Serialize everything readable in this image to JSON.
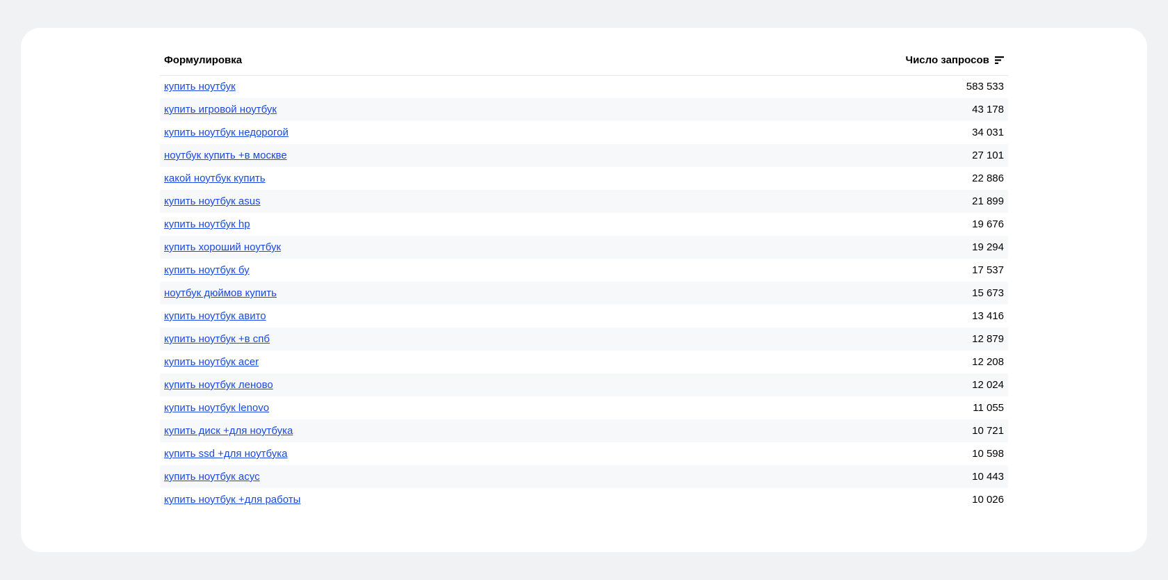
{
  "table": {
    "header": {
      "query": "Формулировка",
      "count": "Число запросов"
    },
    "rows": [
      {
        "query": "купить ноутбук",
        "count": "583 533"
      },
      {
        "query": "купить игровой ноутбук",
        "count": "43 178"
      },
      {
        "query": "купить ноутбук недорогой",
        "count": "34 031"
      },
      {
        "query": "ноутбук купить +в москве",
        "count": "27 101"
      },
      {
        "query": "какой ноутбук купить",
        "count": "22 886"
      },
      {
        "query": "купить ноутбук asus",
        "count": "21 899"
      },
      {
        "query": "купить ноутбук hp",
        "count": "19 676"
      },
      {
        "query": "купить хороший ноутбук",
        "count": "19 294"
      },
      {
        "query": "купить ноутбук бу",
        "count": "17 537"
      },
      {
        "query": "ноутбук дюймов купить",
        "count": "15 673"
      },
      {
        "query": "купить ноутбук авито",
        "count": "13 416"
      },
      {
        "query": "купить ноутбук +в спб",
        "count": "12 879"
      },
      {
        "query": "купить ноутбук acer",
        "count": "12 208"
      },
      {
        "query": "купить ноутбук леново",
        "count": "12 024"
      },
      {
        "query": "купить ноутбук lenovo",
        "count": "11 055"
      },
      {
        "query": "купить диск +для ноутбука",
        "count": "10 721"
      },
      {
        "query": "купить ssd +для ноутбука",
        "count": "10 598"
      },
      {
        "query": "купить ноутбук асус",
        "count": "10 443"
      },
      {
        "query": "купить ноутбук +для работы",
        "count": "10 026"
      }
    ]
  }
}
